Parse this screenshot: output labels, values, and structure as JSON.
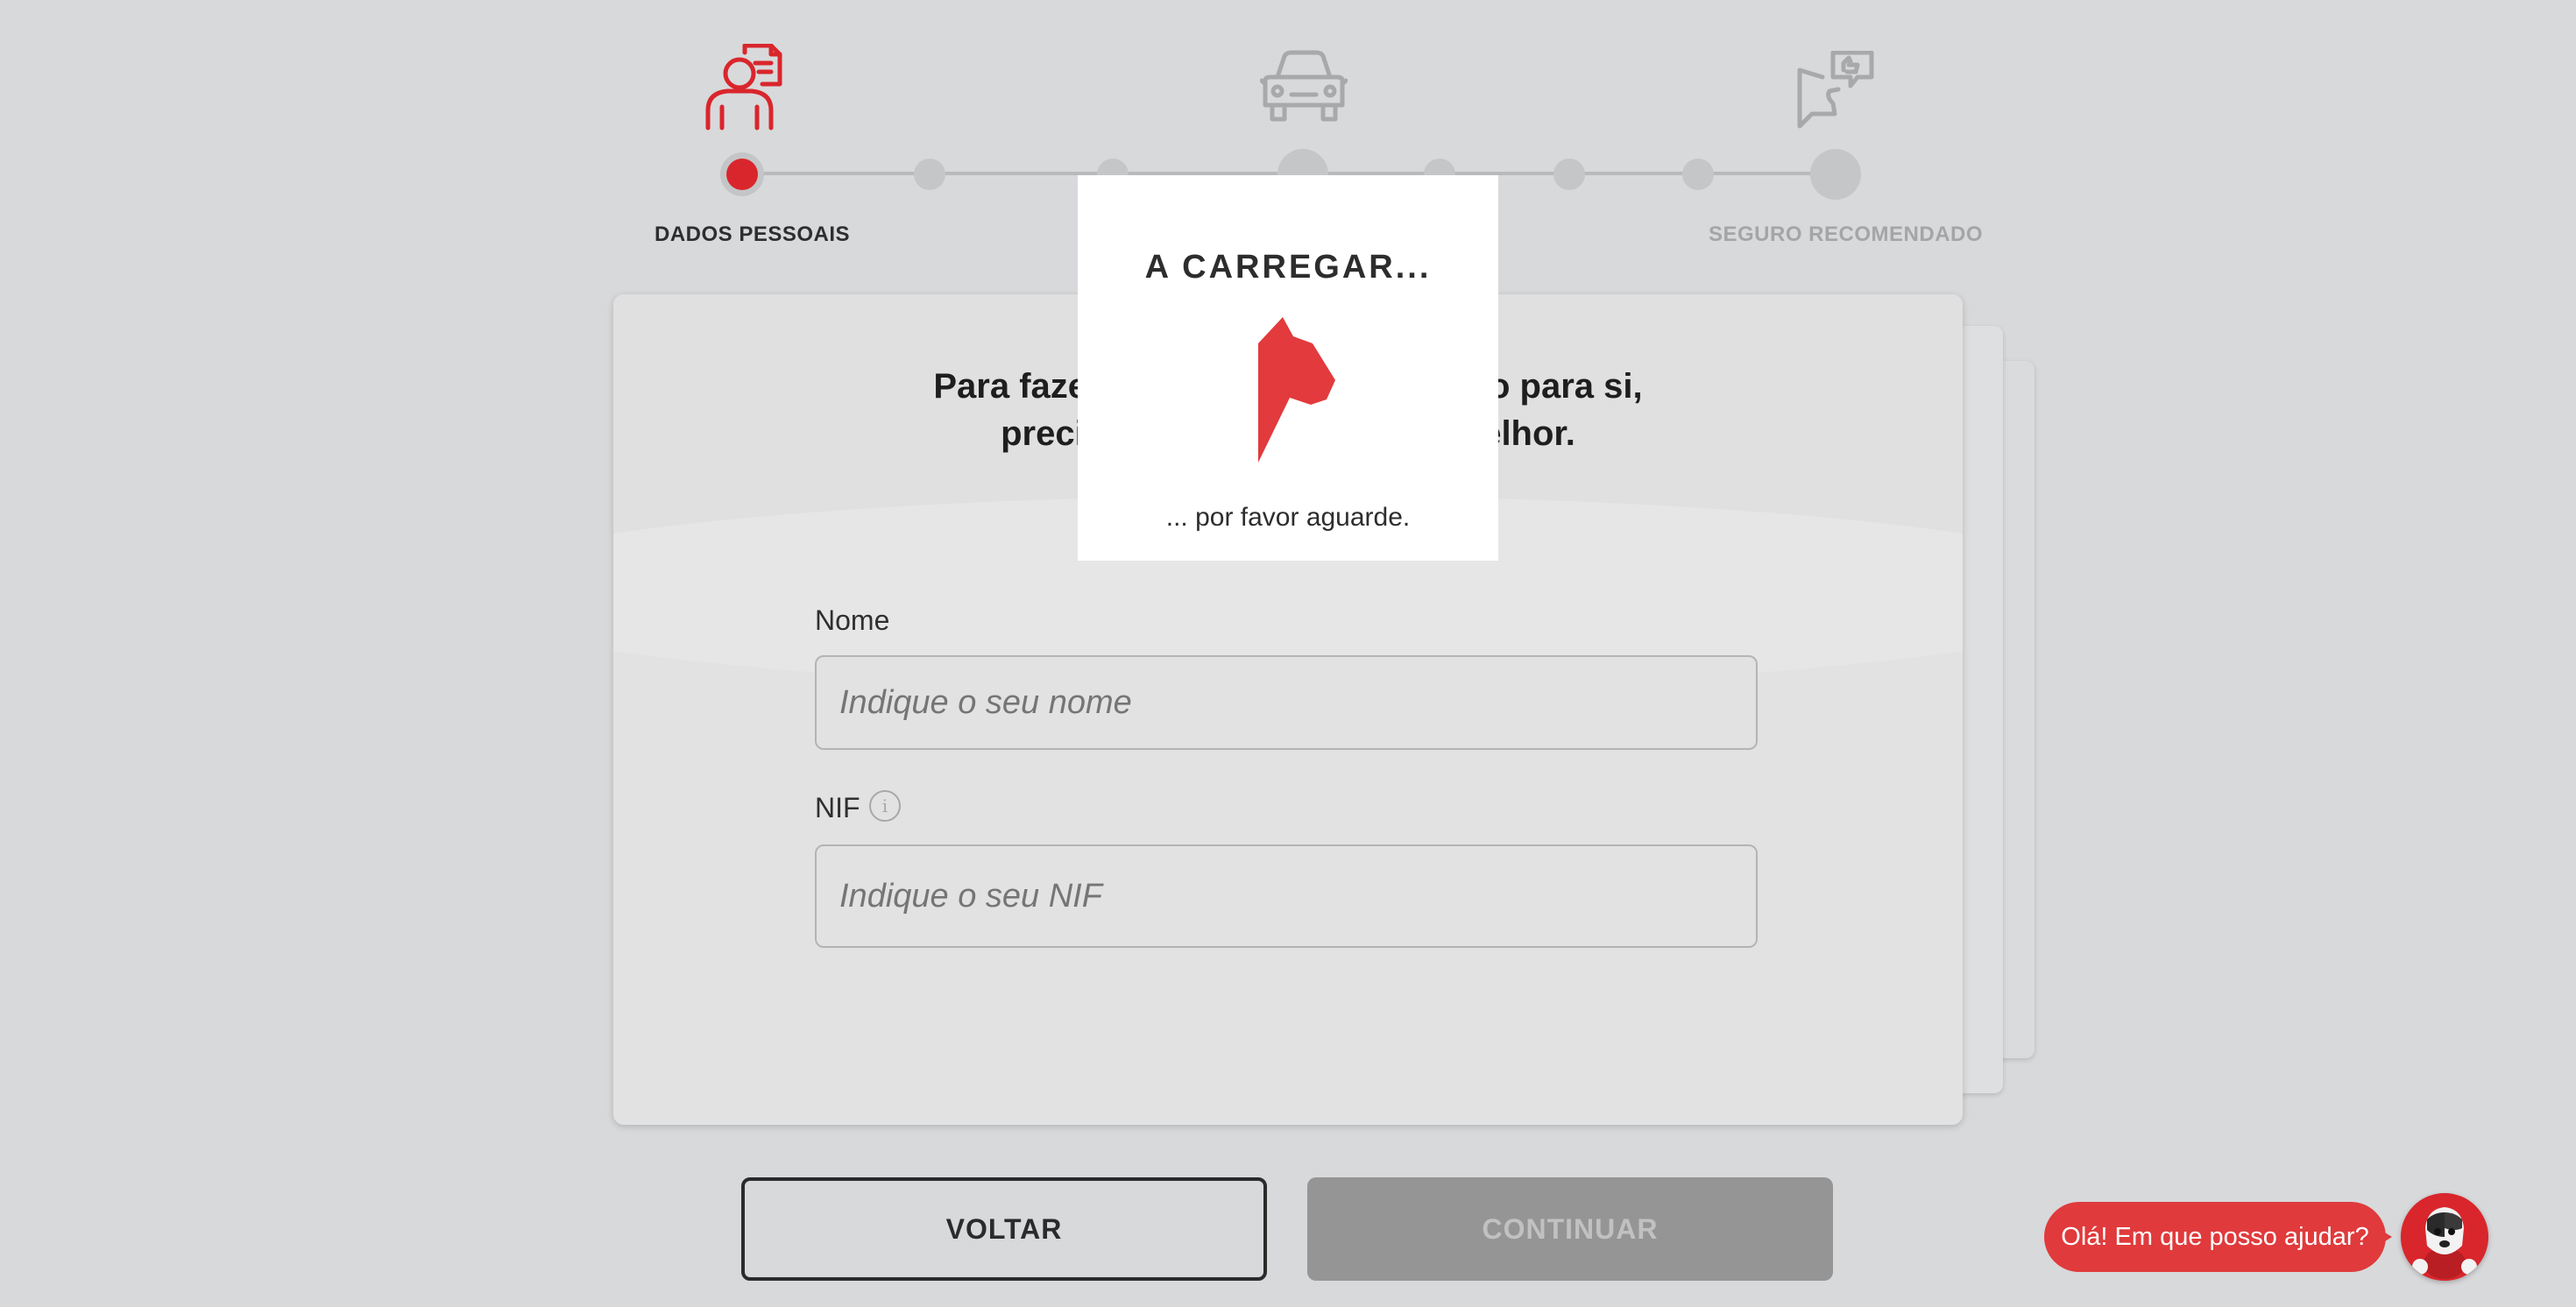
{
  "stepper": {
    "steps": [
      {
        "label": "DADOS PESSOAIS",
        "icon": "person-document-icon",
        "state": "active"
      },
      {
        "label": "",
        "icon": "car-icon",
        "state": "pending"
      },
      {
        "label": "SEGURO RECOMENDADO",
        "icon": "speech-thumbs-up-icon",
        "state": "pending"
      }
    ]
  },
  "form": {
    "intro_line1": "Para fazermos a melhor simulação para si,",
    "intro_line2": "precisamos de conhecê-lo melhor.",
    "name_label": "Nome",
    "name_placeholder": "Indique o seu nome",
    "nif_label": "NIF",
    "nif_placeholder": "Indique o seu NIF",
    "info_glyph": "i"
  },
  "buttons": {
    "back": "VOLTAR",
    "continue": "CONTINUAR"
  },
  "loading": {
    "title": "A CARREGAR...",
    "subtitle": "... por favor aguarde."
  },
  "chat": {
    "greeting": "Olá! Em que posso ajudar?"
  },
  "colors": {
    "accent": "#d9262c",
    "background": "#d8d9db",
    "disabled_button": "#959596"
  }
}
